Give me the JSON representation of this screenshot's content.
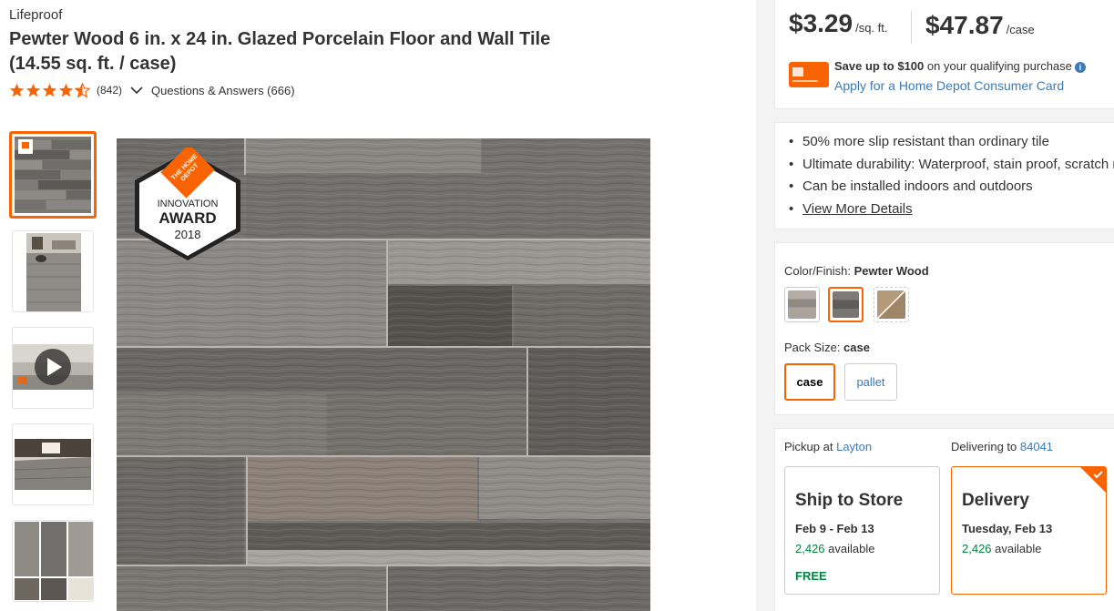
{
  "product": {
    "brand": "Lifeproof",
    "title_line1": "Pewter Wood 6 in. x 24 in. Glazed Porcelain Floor and Wall Tile",
    "title_line2": "(14.55 sq. ft. / case)",
    "rating": 4.5,
    "rating_count": "(842)",
    "qa_label": "Questions & Answers (666)"
  },
  "gallery": {
    "thumbnails": [
      "tile-photo",
      "room-photo",
      "video",
      "room-photo-2",
      "swatch-sheet"
    ],
    "award": {
      "brand": "THE HOME DEPOT",
      "line1": "INNOVATION",
      "line2": "AWARD",
      "year": "2018"
    }
  },
  "pricing": {
    "price_sqft": "$3.29",
    "unit_sqft": "/sq. ft.",
    "price_case": "$47.87",
    "unit_case": "/case",
    "save_bold": "Save up to $100",
    "save_rest": " on your qualifying purchase",
    "apply_link": "Apply for a Home Depot Consumer Card"
  },
  "highlights": {
    "items": [
      "50% more slip resistant than ordinary tile",
      "Ultimate durability: Waterproof, stain proof, scratch resistant",
      "Can be installed indoors and outdoors"
    ],
    "more_link": "View More Details"
  },
  "options": {
    "color_label": "Color/Finish: ",
    "color_value": "Pewter Wood",
    "swatches": [
      {
        "name": "light-grey-wood",
        "color": "#a8a39c"
      },
      {
        "name": "pewter-wood",
        "color": "#6f6d6a"
      },
      {
        "name": "tan-wood",
        "color": "#a88f6f"
      }
    ],
    "pack_label": "Pack Size: ",
    "pack_value": "case",
    "pack_options": [
      "case",
      "pallet"
    ]
  },
  "fulfillment": {
    "pickup_label": "Pickup at ",
    "pickup_store": "Layton",
    "deliver_label": "Delivering to ",
    "deliver_zip": "84041",
    "ship": {
      "title": "Ship to Store",
      "date": "Feb 9 - Feb 13",
      "count": "2,426",
      "avail": " available",
      "free": "FREE"
    },
    "delivery": {
      "title": "Delivery",
      "date": "Tuesday, Feb 13",
      "count": "2,426",
      "avail": " available"
    }
  },
  "colors": {
    "accent": "#f96302",
    "link": "#3e7ab5",
    "green": "#00853e"
  }
}
